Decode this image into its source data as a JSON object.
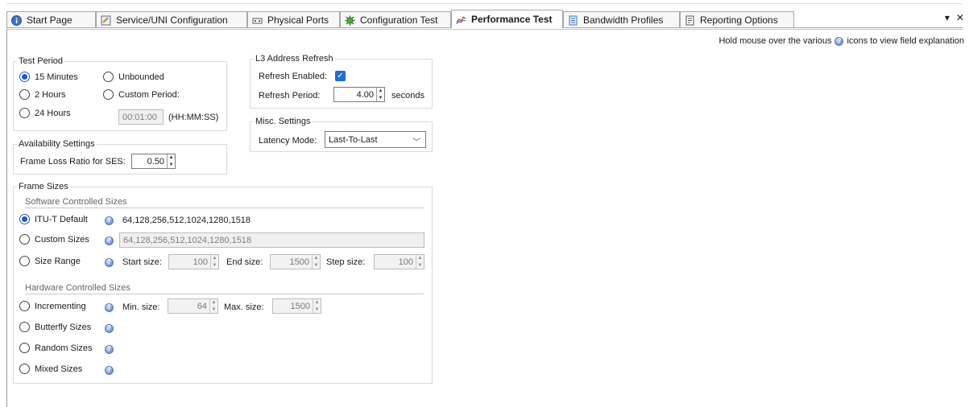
{
  "tabs": [
    {
      "label": "Start Page",
      "icon": "info-icon"
    },
    {
      "label": "Service/UNI Configuration",
      "icon": "service-config-icon"
    },
    {
      "label": "Physical Ports",
      "icon": "ports-icon"
    },
    {
      "label": "Configuration Test",
      "icon": "config-test-icon"
    },
    {
      "label": "Performance Test",
      "icon": "performance-icon",
      "active": true
    },
    {
      "label": "Bandwidth Profiles",
      "icon": "bandwidth-icon"
    },
    {
      "label": "Reporting Options",
      "icon": "reporting-icon"
    }
  ],
  "window": {
    "dropdown": "▾",
    "close": "✕"
  },
  "hint": {
    "before": "Hold mouse over the various",
    "after": "icons to view field explanation"
  },
  "test_period": {
    "legend": "Test Period",
    "opt_15min": "15 Minutes",
    "opt_unbounded": "Unbounded",
    "opt_2h": "2 Hours",
    "opt_custom": "Custom Period:",
    "opt_24h": "24 Hours",
    "custom_value": "00:01:00",
    "custom_format": "(HH:MM:SS)",
    "selected": "15 Minutes"
  },
  "availability": {
    "legend": "Availability Settings",
    "flr_label": "Frame Loss Ratio for SES:",
    "flr_value": "0.50"
  },
  "l3_refresh": {
    "legend": "L3 Address Refresh",
    "enabled_label": "Refresh Enabled:",
    "enabled": true,
    "period_label": "Refresh Period:",
    "period_value": "4.00",
    "period_unit": "seconds"
  },
  "misc": {
    "legend": "Misc. Settings",
    "latency_label": "Latency Mode:",
    "latency_value": "Last-To-Last"
  },
  "frame_sizes": {
    "legend": "Frame Sizes",
    "software_header": "Software Controlled Sizes",
    "itu_label": "ITU-T Default",
    "itu_value": "64,128,256,512,1024,1280,1518",
    "custom_label": "Custom Sizes",
    "custom_value": "64,128,256,512,1024,1280,1518",
    "range_label": "Size Range",
    "start_label": "Start size:",
    "start_value": "100",
    "end_label": "End size:",
    "end_value": "1500",
    "step_label": "Step size:",
    "step_value": "100",
    "hardware_header": "Hardware Controlled Sizes",
    "incr_label": "Incrementing",
    "min_label": "Min. size:",
    "min_value": "64",
    "max_label": "Max. size:",
    "max_value": "1500",
    "butterfly_label": "Butterfly Sizes",
    "random_label": "Random Sizes",
    "mixed_label": "Mixed Sizes",
    "selected": "ITU-T Default"
  },
  "colors": {
    "accent": "#1e5bc6",
    "checkbox": "#1e6fd0"
  }
}
